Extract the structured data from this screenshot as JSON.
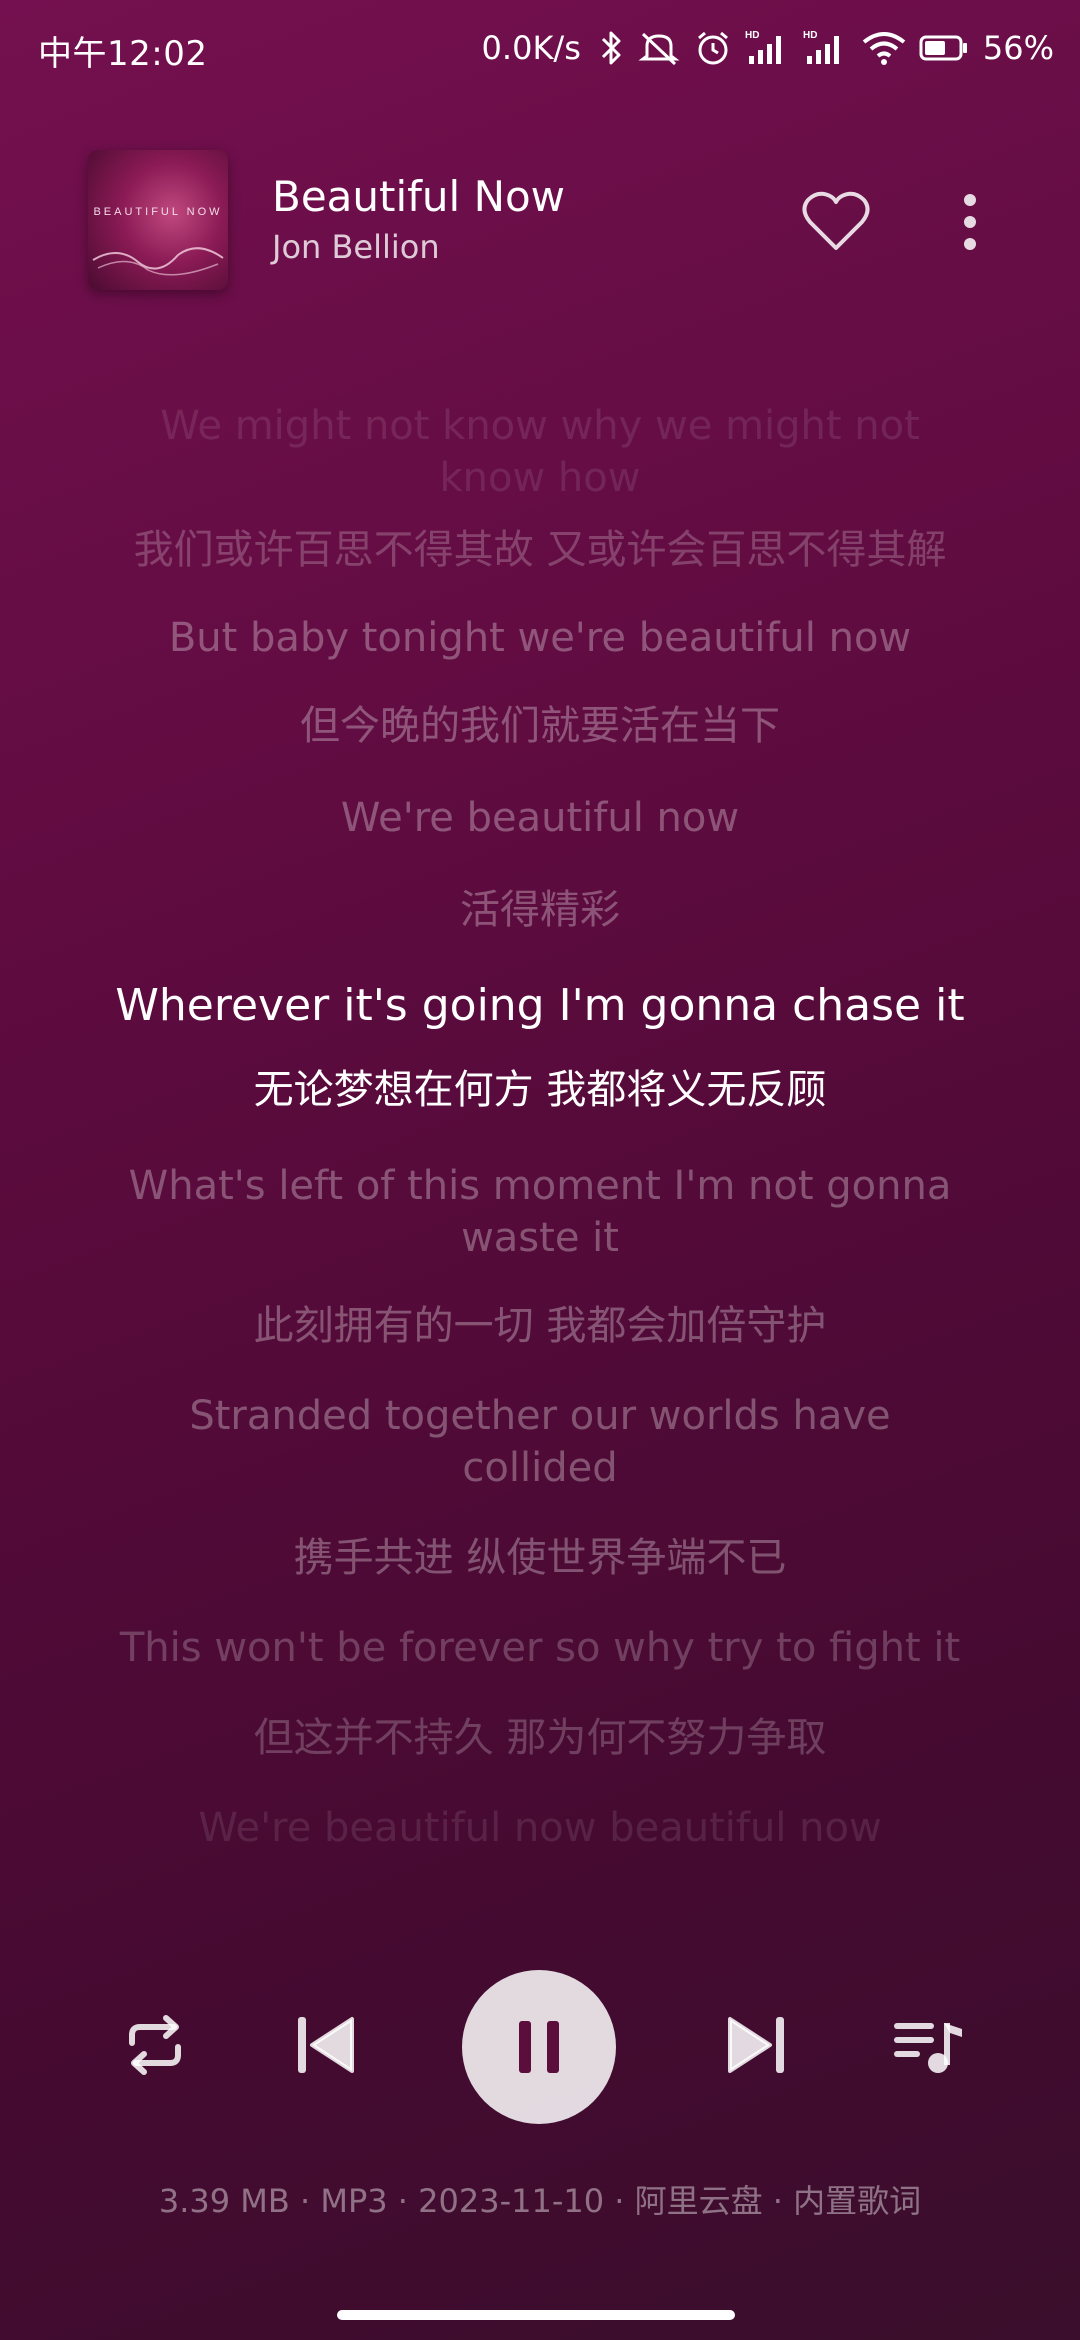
{
  "status_bar": {
    "time": "中午12:02",
    "net_speed": "0.0K/s",
    "battery": "56%",
    "icons": [
      "bluetooth-icon",
      "mute-icon",
      "alarm-icon",
      "signal-hd-icon",
      "signal-hd-icon",
      "wifi-icon",
      "battery-icon"
    ]
  },
  "song": {
    "title": "Beautiful Now",
    "artist": "Jon Bellion",
    "album_art_text": "BEAUTIFUL NOW"
  },
  "lyrics": [
    {
      "text": "We might not know why we might not know how",
      "state": "dim1"
    },
    {
      "text": "我们或许百思不得其故 又或许会百思不得其解",
      "state": "dim2"
    },
    {
      "text": "But baby tonight we're beautiful now",
      "state": "dim3"
    },
    {
      "text": "但今晚的我们就要活在当下",
      "state": "dim3"
    },
    {
      "text": "We're beautiful now",
      "state": "dim3"
    },
    {
      "text": "活得精彩",
      "state": "dim3"
    },
    {
      "text": "Wherever it's going I'm gonna chase it",
      "state": "active"
    },
    {
      "text": "无论梦想在何方 我都将义无反顾",
      "state": "active-zh"
    },
    {
      "text": "What's left of this moment I'm not gonna waste it",
      "state": "dim3"
    },
    {
      "text": "此刻拥有的一切 我都会加倍守护",
      "state": "dim3"
    },
    {
      "text": "Stranded together our worlds have collided",
      "state": "dim3"
    },
    {
      "text": "携手共进 纵使世界争端不已",
      "state": "dim3"
    },
    {
      "text": "This won't be forever so why try to fight it",
      "state": "fade1"
    },
    {
      "text": "但这并不持久 那为何不努力争取",
      "state": "fade1"
    },
    {
      "text": "We're beautiful now beautiful now",
      "state": "fade2"
    }
  ],
  "controls": {
    "repeat": "repeat-icon",
    "previous": "skip-previous-icon",
    "play_pause": "pause-icon",
    "next": "skip-next-icon",
    "queue": "playlist-icon"
  },
  "file_info": "3.39 MB · MP3 · 2023-11-10 · 阿里云盘 · 内置歌词"
}
